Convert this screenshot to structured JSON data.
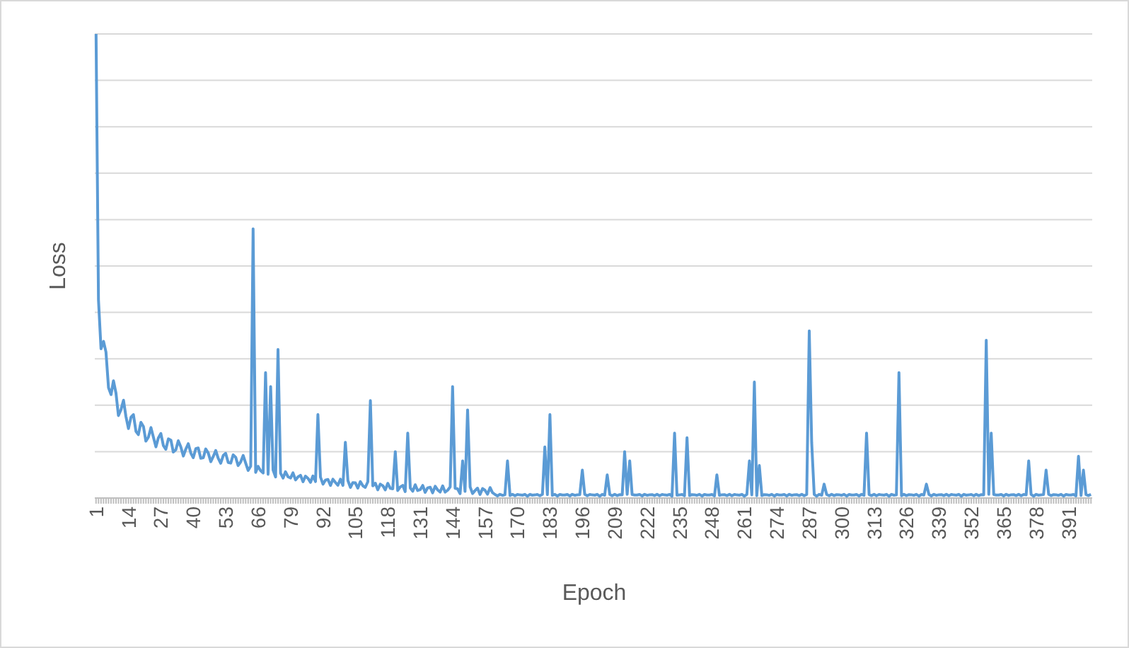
{
  "chart": {
    "ylabel": "Loss",
    "xlabel": "Epoch",
    "xtick_labels": [
      "1",
      "14",
      "27",
      "40",
      "53",
      "66",
      "79",
      "92",
      "105",
      "118",
      "131",
      "144",
      "157",
      "170",
      "183",
      "196",
      "209",
      "222",
      "235",
      "248",
      "261",
      "274",
      "287",
      "300",
      "313",
      "326",
      "339",
      "352",
      "365",
      "378",
      "391"
    ]
  }
}
